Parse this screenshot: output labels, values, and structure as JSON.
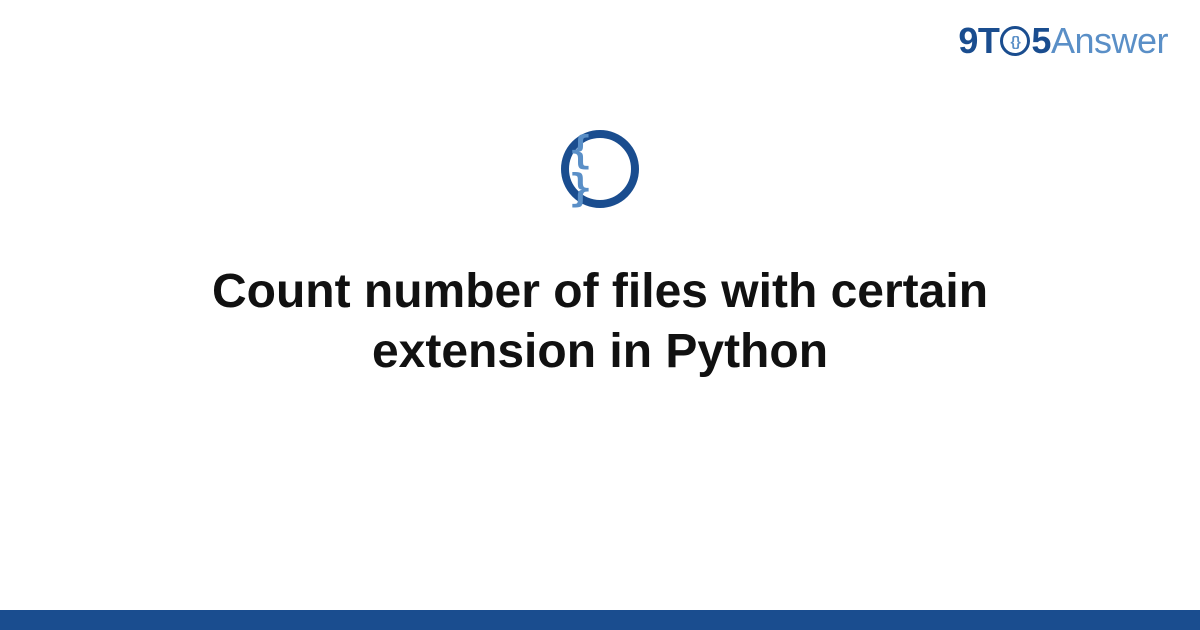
{
  "brand": {
    "part1": "9T",
    "o_inner": "{}",
    "part2": "5",
    "part3": "Answer"
  },
  "icon": {
    "braces": "{ }"
  },
  "title": "Count number of files with certain extension in Python",
  "colors": {
    "primary": "#1a4d8f",
    "secondary": "#5a8fc7",
    "text": "#111111"
  }
}
